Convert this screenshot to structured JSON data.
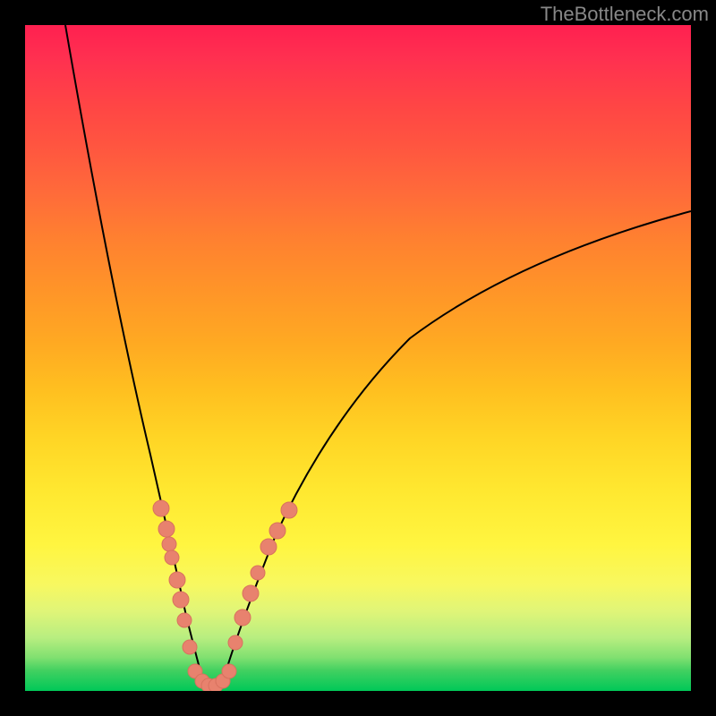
{
  "watermark": "TheBottleneck.com",
  "chart_data": {
    "type": "line",
    "title": "",
    "xlabel": "",
    "ylabel": "",
    "xlim": [
      0,
      100
    ],
    "ylim": [
      0,
      100
    ],
    "background_gradient": {
      "type": "performance",
      "top_color": "#ff2050",
      "bottom_color": "#00c858"
    },
    "series": [
      {
        "name": "bottleneck-curve",
        "type": "v-curve",
        "color": "#000000",
        "minimum_x": 27,
        "minimum_y": 0,
        "left_start": {
          "x": 6,
          "y": 100
        },
        "right_end": {
          "x": 100,
          "y": 72
        }
      }
    ],
    "markers": {
      "color": "#e8826e",
      "left_branch_points": [
        {
          "x": 20.5,
          "y": 28
        },
        {
          "x": 21.5,
          "y": 25
        },
        {
          "x": 21.8,
          "y": 23
        },
        {
          "x": 22.2,
          "y": 21
        },
        {
          "x": 23.0,
          "y": 17
        },
        {
          "x": 23.5,
          "y": 14
        },
        {
          "x": 24.0,
          "y": 11
        },
        {
          "x": 24.8,
          "y": 7
        }
      ],
      "right_branch_points": [
        {
          "x": 29.5,
          "y": 8
        },
        {
          "x": 30.5,
          "y": 12
        },
        {
          "x": 31.5,
          "y": 15
        },
        {
          "x": 32.5,
          "y": 18
        },
        {
          "x": 34.0,
          "y": 22
        },
        {
          "x": 35.0,
          "y": 24
        },
        {
          "x": 36.5,
          "y": 27
        }
      ],
      "bottom_arc_points": [
        {
          "x": 25.5,
          "y": 2.5
        },
        {
          "x": 26.5,
          "y": 1.5
        },
        {
          "x": 27.5,
          "y": 1.5
        },
        {
          "x": 28.5,
          "y": 2.5
        }
      ]
    }
  }
}
